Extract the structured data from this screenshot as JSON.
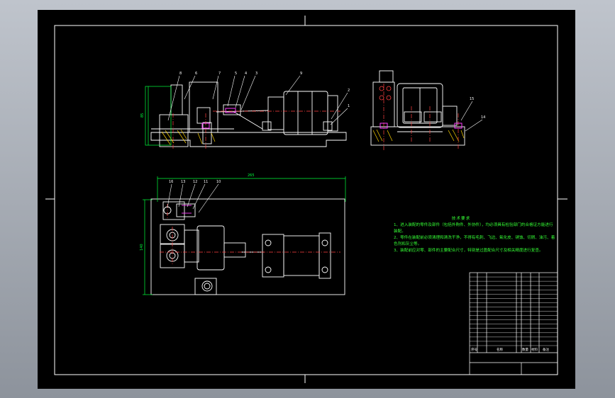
{
  "colors": {
    "background": "#000000",
    "frame": "#ffffff",
    "outline": "#ffffff",
    "dimension": "#00ff3c",
    "notes_text": "#35ff35",
    "centerline": "#ff4040",
    "highlight": "#ff3cff",
    "hatch": "#ffd400"
  },
  "technical_requirements": {
    "title": "技术要求",
    "lines": [
      "1、进入装配的零件及部件（包括外购件、外协件），均必须具有检验部门的合格证方能进行装配。",
      "2、零件在装配前必须清理和清洗干净，不得有毛刺、飞边、氧化皮、锈蚀、切屑、油污、着色剂和灰尘等。",
      "3、装配前应对零、部件的主要配合尺寸，特别是过盈配合尺寸及相关精度进行复查。"
    ]
  },
  "dimensions": {
    "front_height": "85",
    "plan_width": "265",
    "plan_height": "140"
  },
  "balloons": {
    "front_view": [
      "8",
      "6",
      "7",
      "5",
      "4",
      "3",
      "9",
      "2",
      "1"
    ],
    "side_view": [
      "15",
      "14"
    ],
    "plan_view": [
      "16",
      "13",
      "12",
      "11",
      "10"
    ]
  },
  "bom": {
    "rows": 17,
    "footer_labels": [
      "序号",
      "名称",
      "数量",
      "材料",
      "备注"
    ]
  }
}
